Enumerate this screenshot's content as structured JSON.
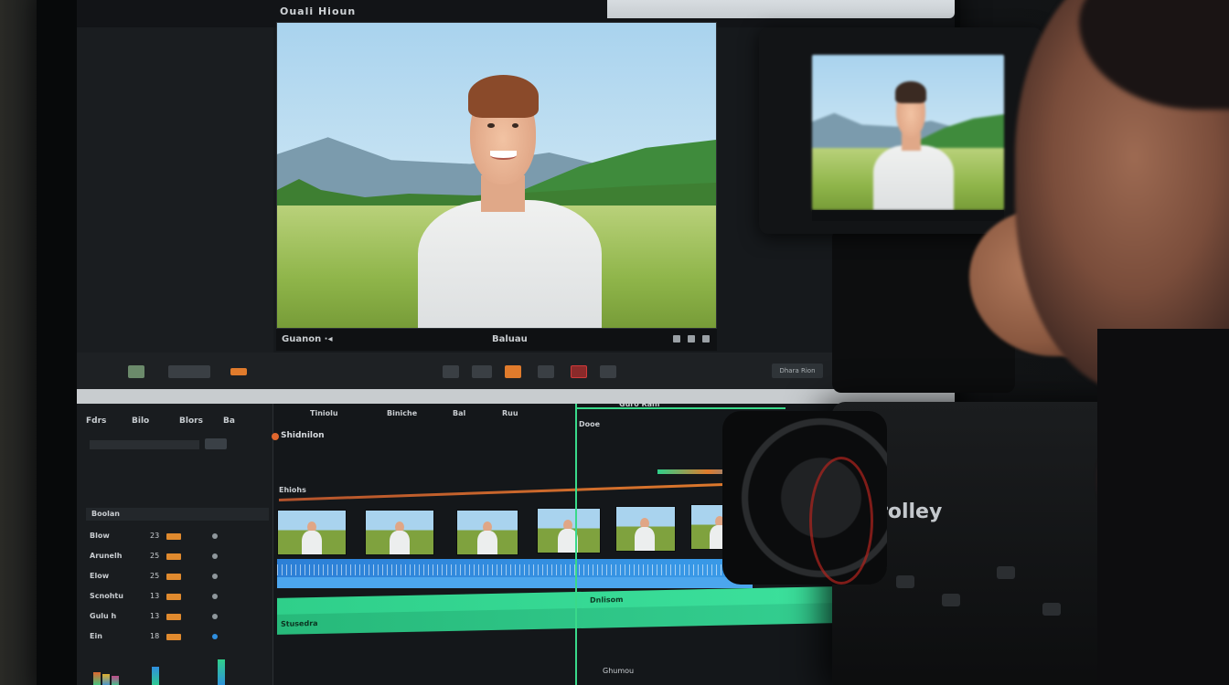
{
  "app": {
    "title": "Ouali Hioun"
  },
  "viewer": {
    "left_label": "Guanon ·◂",
    "center_label": "Baluau",
    "controls": [
      "play-icon",
      "pause-icon",
      "record-icon"
    ]
  },
  "transport": {
    "right_label": "Dhara Rion"
  },
  "timeline": {
    "left_menu": [
      "Fdrs",
      "Bilo",
      "Blors",
      "Ba"
    ],
    "header_labels": [
      "Tiniolu",
      "Biniche",
      "Bal",
      "Ruu",
      "Guro Ranl"
    ],
    "section_label": "Boolan",
    "track_title": "Shidnilon",
    "track_small": "Ehiohs",
    "playhead_label": "Dooe",
    "green_label": "Dnlisom",
    "green_label_2": "Stusedra",
    "bottom_label": "Ghumou",
    "channels": [
      {
        "name": "Blow",
        "value": "23"
      },
      {
        "name": "Arunelh",
        "value": "25"
      },
      {
        "name": "Elow",
        "value": "25"
      },
      {
        "name": "Scnohtu",
        "value": "13"
      },
      {
        "name": "Gulu h",
        "value": "13"
      },
      {
        "name": "Ein",
        "value": "18"
      }
    ]
  },
  "camera": {
    "brand": "rolley"
  },
  "colors": {
    "accent_green": "#39d98a",
    "accent_orange": "#e07b2c",
    "accent_blue": "#2c7fd6",
    "record_red": "#e21d2e"
  }
}
